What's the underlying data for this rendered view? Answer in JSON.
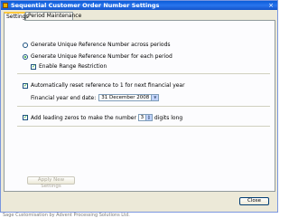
{
  "window": {
    "title": "Sequential Customer Order Number Settings",
    "close_glyph": "×"
  },
  "tabs": [
    {
      "label": "Settings",
      "active": true
    },
    {
      "label": "Period Maintenance",
      "active": false
    }
  ],
  "numbering": {
    "option_across_periods": "Generate Unique Reference Number across periods",
    "option_each_period": "Generate Unique Reference Number for each period",
    "selected": "each_period",
    "range_restriction_label": "Enable Range Restriction",
    "range_restriction_checked": true
  },
  "financial_year": {
    "reset_label": "Automatically reset reference to 1 for next financial year",
    "reset_checked": true,
    "end_date_label": "Financial year end date:",
    "end_date_value": "31 December 2008"
  },
  "leading_zeros": {
    "checked": true,
    "label_before": "Add leading zeros to make the number",
    "digits_value": "3",
    "label_after": "digits long"
  },
  "buttons": {
    "apply_new_settings": "Apply New Settings",
    "close": "Close"
  },
  "status": {
    "text": "Sage Customisation by Advent Processing Solutions Ltd."
  }
}
